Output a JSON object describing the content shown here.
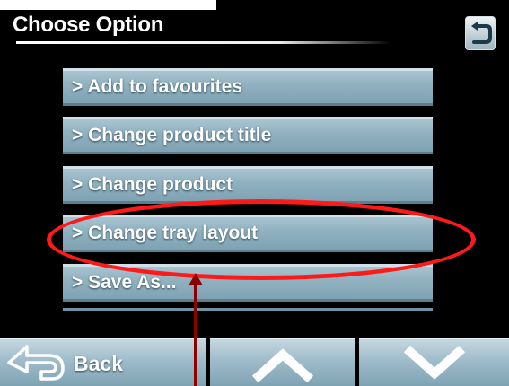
{
  "header": {
    "title": "Choose Option",
    "return_icon": "return-arrow-icon"
  },
  "menu": {
    "items": [
      {
        "label": "> Add to favourites"
      },
      {
        "label": "> Change product title"
      },
      {
        "label": "> Change product"
      },
      {
        "label": "> Change tray layout"
      },
      {
        "label": "> Save As..."
      }
    ],
    "highlighted_item": "> Change tray layout"
  },
  "bottom_bar": {
    "back_label": "Back",
    "back_icon": "back-arrow-icon",
    "up_icon": "chevron-up-icon",
    "down_icon": "chevron-down-icon"
  },
  "colors": {
    "background": "#000000",
    "button_blue": "#8fb0bf",
    "highlight_red": "#ff1a1a",
    "pointer": "#8b0000"
  }
}
